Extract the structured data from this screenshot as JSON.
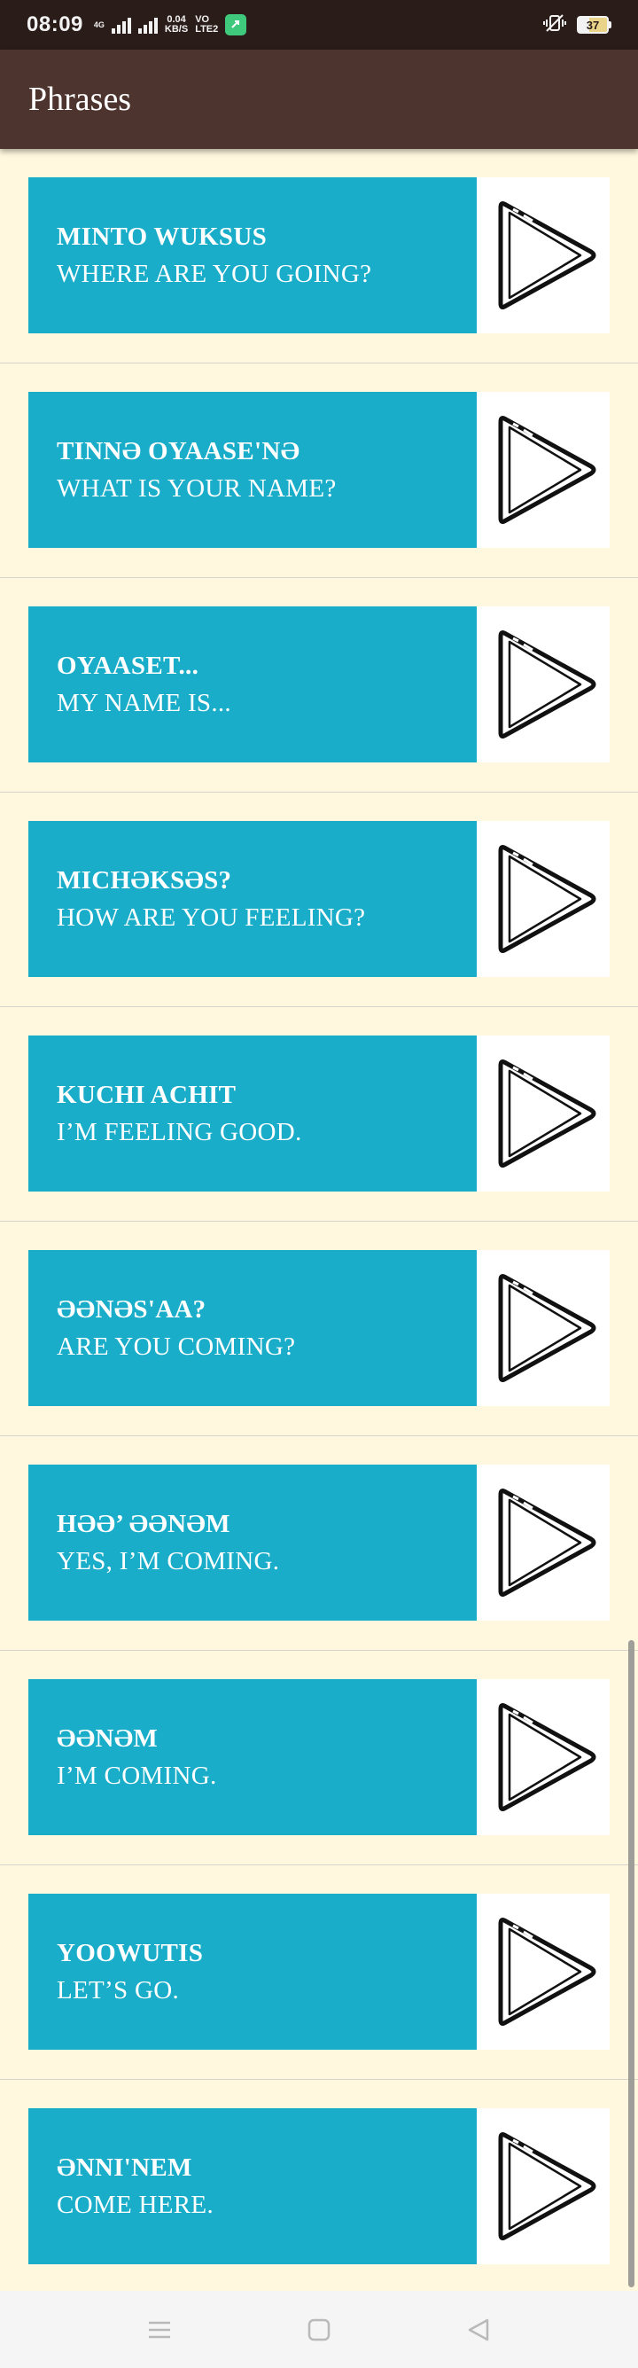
{
  "status_bar": {
    "time": "08:09",
    "network_small_top": "4G",
    "network_speed_value": "0.04",
    "network_speed_unit": "KB/S",
    "vo_top": "VO",
    "vo_bottom": "LTE2",
    "battery_level": "37"
  },
  "app_bar": {
    "title": "Phrases"
  },
  "phrases": [
    {
      "native": "MINTO WUKSUS",
      "english": "WHERE ARE YOU GOING?"
    },
    {
      "native": "TINNƏ OYAASE'NƏ",
      "english": "WHAT IS YOUR NAME?"
    },
    {
      "native": "OYAASET...",
      "english": "MY NAME IS..."
    },
    {
      "native": "MICHƏKSƏS?",
      "english": "HOW ARE YOU FEELING?"
    },
    {
      "native": "KUCHI ACHIT",
      "english": "I’M FEELING GOOD."
    },
    {
      "native": "ƏƏNƏS'AA?",
      "english": "ARE YOU COMING?"
    },
    {
      "native": "HƏƏ’ ƏƏNƏM",
      "english": "YES, I’M COMING."
    },
    {
      "native": "ƏƏNƏM",
      "english": "I’M COMING."
    },
    {
      "native": "YOOWUTIS",
      "english": "LET’S GO."
    },
    {
      "native": "ƏNNI'NEM",
      "english": "COME HERE."
    }
  ],
  "icons": {
    "play": "play-icon",
    "menu": "menu-icon",
    "home": "home-icon",
    "back": "back-icon"
  },
  "colors": {
    "status_bar": "#2a1c18",
    "app_bar": "#4e342e",
    "background": "#fff8de",
    "card": "#19adc9",
    "play_bg": "#ffffff"
  }
}
